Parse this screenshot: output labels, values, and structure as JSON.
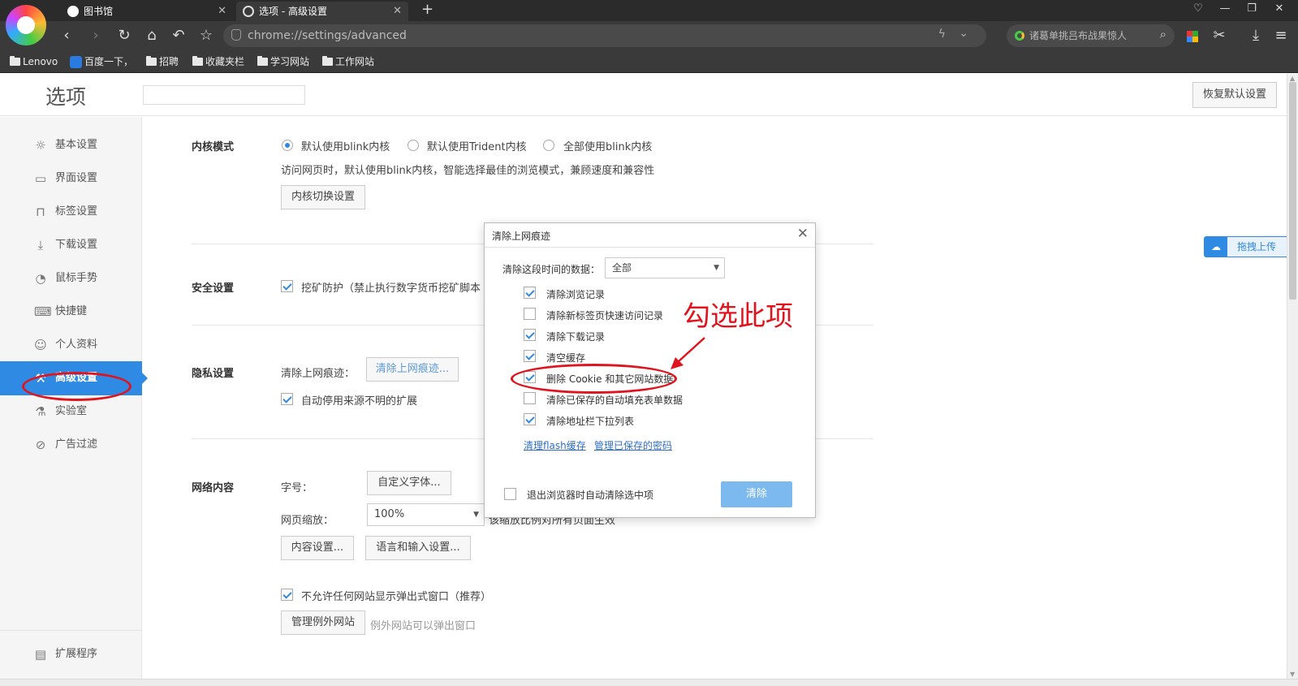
{
  "browser": {
    "tabs": [
      {
        "label": "图书馆"
      },
      {
        "label": "选项 - 高级设置"
      }
    ],
    "url": "chrome://settings/advanced",
    "search_placeholder": "诸葛单挑吕布战果惊人",
    "bookmarks": [
      "Lenovo",
      "百度一下，",
      "招聘",
      "收藏夹栏",
      "学习网站",
      "工作网站"
    ]
  },
  "page": {
    "title": "选项",
    "restore_button": "恢复默认设置",
    "upload_label": "拖拽上传"
  },
  "sidebar": {
    "items": [
      {
        "label": "基本设置",
        "icon": "gear-icon"
      },
      {
        "label": "界面设置",
        "icon": "window-icon"
      },
      {
        "label": "标签设置",
        "icon": "tab-icon"
      },
      {
        "label": "下载设置",
        "icon": "download-icon"
      },
      {
        "label": "鼠标手势",
        "icon": "mouse-icon"
      },
      {
        "label": "快捷键",
        "icon": "keyboard-icon"
      },
      {
        "label": "个人资料",
        "icon": "user-icon"
      },
      {
        "label": "高级设置",
        "icon": "wrench-icon",
        "active": true
      },
      {
        "label": "实验室",
        "icon": "flask-icon"
      },
      {
        "label": "广告过滤",
        "icon": "block-icon"
      }
    ],
    "extensions": "扩展程序"
  },
  "kernel": {
    "title": "内核模式",
    "options": [
      "默认使用blink内核",
      "默认使用Trident内核",
      "全部使用blink内核"
    ],
    "description": "访问网页时，默认使用blink内核，智能选择最佳的浏览模式，兼顾速度和兼容性",
    "switch_button": "内核切换设置"
  },
  "security": {
    "title": "安全设置",
    "mining_protection": "挖矿防护（禁止执行数字货币挖矿脚本"
  },
  "privacy": {
    "title": "隐私设置",
    "clear_label": "清除上网痕迹：",
    "clear_button": "清除上网痕迹...",
    "auto_disable_ext": "自动停用来源不明的扩展"
  },
  "network": {
    "title": "网络内容",
    "font_label": "字号：",
    "font_button": "自定义字体...",
    "zoom_label": "网页缩放：",
    "zoom_value": "100%",
    "zoom_note": "该缩放比例对所有页面生效",
    "content_button": "内容设置...",
    "language_button": "语言和输入设置...",
    "popup_block": "不允许任何网站显示弹出式窗口（推荐）",
    "exceptions_button": "管理例外网站",
    "exceptions_note": "例外网站可以弹出窗口"
  },
  "dialog": {
    "title": "清除上网痕迹",
    "period_label": "清除这段时间的数据：",
    "period_value": "全部",
    "options": [
      {
        "label": "清除浏览记录",
        "checked": true
      },
      {
        "label": "清除新标签页快速访问记录",
        "checked": false
      },
      {
        "label": "清除下载记录",
        "checked": true
      },
      {
        "label": "清空缓存",
        "checked": true
      },
      {
        "label": "删除 Cookie 和其它网站数据",
        "checked": true
      },
      {
        "label": "清除已保存的自动填充表单数据",
        "checked": false
      },
      {
        "label": "清除地址栏下拉列表",
        "checked": true
      }
    ],
    "link_flash": "清理flash缓存",
    "link_passwords": "管理已保存的密码",
    "auto_clear_label": "退出浏览器时自动清除选中项",
    "clear_button": "清除"
  },
  "annotation": {
    "text": "勾选此项",
    "color": "#e0141e"
  },
  "colors": {
    "accent": "#2f8ae4",
    "chrome_dark": "#2b2b2b"
  }
}
